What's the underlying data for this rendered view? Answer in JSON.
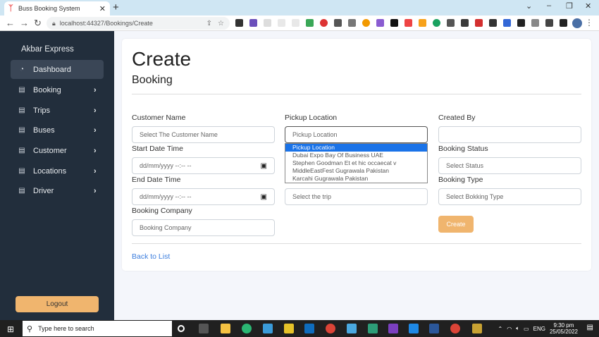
{
  "browser": {
    "tab_title": "Buss Booking System",
    "url_prefix": "localhost",
    "url": "localhost:44327/Bookings/Create",
    "new_tab": "+",
    "close_tab": "✕"
  },
  "sidebar": {
    "brand": "Akbar Express",
    "items": [
      {
        "label": "Dashboard",
        "icon": "dashboard-icon",
        "active": true
      },
      {
        "label": "Booking",
        "icon": "table-icon"
      },
      {
        "label": "Trips",
        "icon": "table-icon"
      },
      {
        "label": "Buses",
        "icon": "table-icon"
      },
      {
        "label": "Customer",
        "icon": "table-icon"
      },
      {
        "label": "Locations",
        "icon": "table-icon"
      },
      {
        "label": "Driver",
        "icon": "table-icon"
      }
    ],
    "logout": "Logout"
  },
  "page": {
    "title": "Create",
    "subtitle": "Booking"
  },
  "form": {
    "customer_name": {
      "label": "Customer Name",
      "placeholder": "Select The Customer Name"
    },
    "pickup_location": {
      "label": "Pickup Location",
      "placeholder": "Pickup Location"
    },
    "created_by": {
      "label": "Created By",
      "value": ""
    },
    "start_date": {
      "label": "Start Date Time",
      "placeholder": "dd/mm/yyyy --:-- --"
    },
    "booking_status": {
      "label": "Booking Status",
      "placeholder": "Select Status"
    },
    "end_date": {
      "label": "End Date Time",
      "placeholder": "dd/mm/yyyy --:-- --"
    },
    "trip": {
      "placeholder": "Select the trip"
    },
    "booking_type": {
      "label": "Booking Type",
      "placeholder": "Select Bokking Type"
    },
    "booking_company": {
      "label": "Booking Company",
      "placeholder": "Booking Company"
    },
    "create_button": "Create",
    "back_link": "Back to List"
  },
  "dropdown": {
    "options": [
      "Pickup Location",
      "Dubai Expo Bay Of Business UAE",
      "Stephen Goodman Et et hic occaecat v",
      "MiddleEastFest Gugrawala Pakistan",
      "Karcahi Gugrawala Pakistan"
    ]
  },
  "taskbar": {
    "search_placeholder": "Type here to search",
    "lang": "ENG",
    "time": "9:30 pm",
    "date": "25/05/2022"
  },
  "colors": {
    "sidebar_bg": "#222e3c",
    "accent": "#f0b56e",
    "link": "#3b7ddd",
    "selected_option": "#1a73e8"
  }
}
